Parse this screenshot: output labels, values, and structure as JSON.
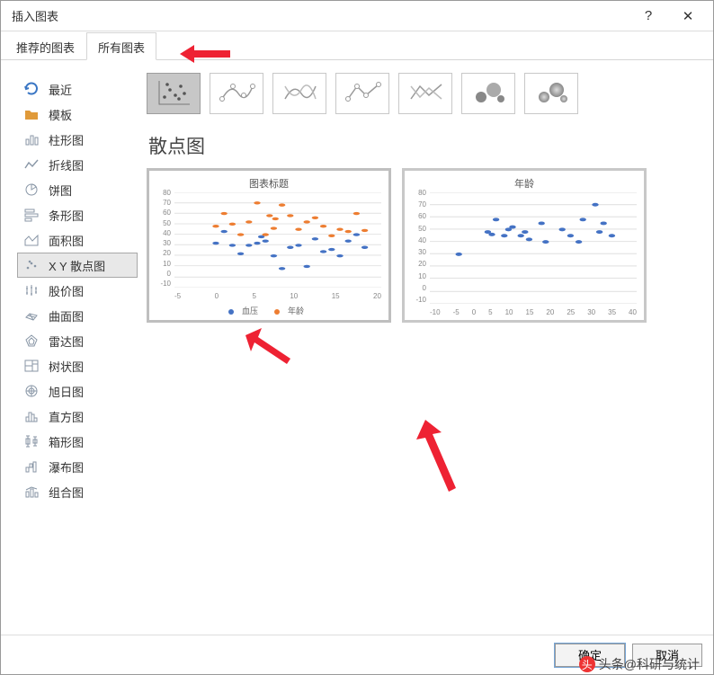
{
  "dialog": {
    "title": "插入图表",
    "help": "?",
    "close": "✕"
  },
  "tabs": {
    "recommended": "推荐的图表",
    "all": "所有图表"
  },
  "sidebar": {
    "items": [
      {
        "key": "recent",
        "label": "最近"
      },
      {
        "key": "template",
        "label": "模板"
      },
      {
        "key": "column",
        "label": "柱形图"
      },
      {
        "key": "line",
        "label": "折线图"
      },
      {
        "key": "pie",
        "label": "饼图"
      },
      {
        "key": "bar",
        "label": "条形图"
      },
      {
        "key": "area",
        "label": "面积图"
      },
      {
        "key": "scatter",
        "label": "X Y 散点图"
      },
      {
        "key": "stock",
        "label": "股价图"
      },
      {
        "key": "surface",
        "label": "曲面图"
      },
      {
        "key": "radar",
        "label": "雷达图"
      },
      {
        "key": "treemap",
        "label": "树状图"
      },
      {
        "key": "sunburst",
        "label": "旭日图"
      },
      {
        "key": "histogram",
        "label": "直方图"
      },
      {
        "key": "boxwhisker",
        "label": "箱形图"
      },
      {
        "key": "waterfall",
        "label": "瀑布图"
      },
      {
        "key": "combo",
        "label": "组合图"
      }
    ]
  },
  "content": {
    "section_title": "散点图",
    "preview1": {
      "title": "图表标题",
      "legend": {
        "s1": "血压",
        "s2": "年龄"
      },
      "color1": "#4472c4",
      "color2": "#ed7d31"
    },
    "preview2": {
      "title": "年龄",
      "color": "#4472c4"
    }
  },
  "footer": {
    "ok": "确定",
    "cancel": "取消"
  },
  "watermark": "头条@科研与统计",
  "chart_data": [
    {
      "type": "scatter",
      "title": "图表标题",
      "xlabel": "",
      "ylabel": "",
      "xlim": [
        -5,
        20
      ],
      "ylim": [
        -10,
        80
      ],
      "xticks": [
        -5,
        0,
        5,
        10,
        15,
        20
      ],
      "yticks": [
        -10,
        0,
        10,
        20,
        30,
        40,
        50,
        60,
        70,
        80
      ],
      "series": [
        {
          "name": "血压",
          "color": "#4472c4",
          "points": [
            [
              0,
              32
            ],
            [
              1,
              43
            ],
            [
              2,
              30
            ],
            [
              3,
              22
            ],
            [
              4,
              30
            ],
            [
              5,
              32
            ],
            [
              5.5,
              38
            ],
            [
              6,
              34
            ],
            [
              7,
              20
            ],
            [
              8,
              8
            ],
            [
              9,
              28
            ],
            [
              10,
              30
            ],
            [
              11,
              10
            ],
            [
              12,
              36
            ],
            [
              13,
              24
            ],
            [
              14,
              26
            ],
            [
              15,
              20
            ],
            [
              16,
              34
            ],
            [
              17,
              40
            ],
            [
              18,
              28
            ]
          ]
        },
        {
          "name": "年龄",
          "color": "#ed7d31",
          "points": [
            [
              0,
              48
            ],
            [
              1,
              60
            ],
            [
              2,
              50
            ],
            [
              3,
              40
            ],
            [
              4,
              52
            ],
            [
              5,
              70
            ],
            [
              6,
              40
            ],
            [
              6.5,
              58
            ],
            [
              7,
              46
            ],
            [
              7.2,
              55
            ],
            [
              8,
              68
            ],
            [
              9,
              58
            ],
            [
              10,
              45
            ],
            [
              11,
              52
            ],
            [
              12,
              56
            ],
            [
              13,
              48
            ],
            [
              14,
              39
            ],
            [
              15,
              45
            ],
            [
              16,
              43
            ],
            [
              17,
              60
            ],
            [
              18,
              44
            ]
          ]
        }
      ]
    },
    {
      "type": "scatter",
      "title": "年龄",
      "xlabel": "",
      "ylabel": "",
      "xlim": [
        -10,
        40
      ],
      "ylim": [
        -10,
        80
      ],
      "xticks": [
        -10,
        -5,
        0,
        5,
        10,
        15,
        20,
        25,
        30,
        35,
        40
      ],
      "yticks": [
        -10,
        0,
        10,
        20,
        30,
        40,
        50,
        60,
        70,
        80
      ],
      "series": [
        {
          "name": "年龄",
          "color": "#4472c4",
          "points": [
            [
              -3,
              30
            ],
            [
              4,
              48
            ],
            [
              5,
              46
            ],
            [
              6,
              58
            ],
            [
              8,
              45
            ],
            [
              9,
              50
            ],
            [
              10,
              52
            ],
            [
              12,
              45
            ],
            [
              13,
              48
            ],
            [
              14,
              42
            ],
            [
              17,
              55
            ],
            [
              18,
              40
            ],
            [
              22,
              50
            ],
            [
              24,
              45
            ],
            [
              26,
              40
            ],
            [
              27,
              58
            ],
            [
              30,
              70
            ],
            [
              31,
              48
            ],
            [
              32,
              55
            ],
            [
              34,
              45
            ]
          ]
        }
      ]
    }
  ]
}
